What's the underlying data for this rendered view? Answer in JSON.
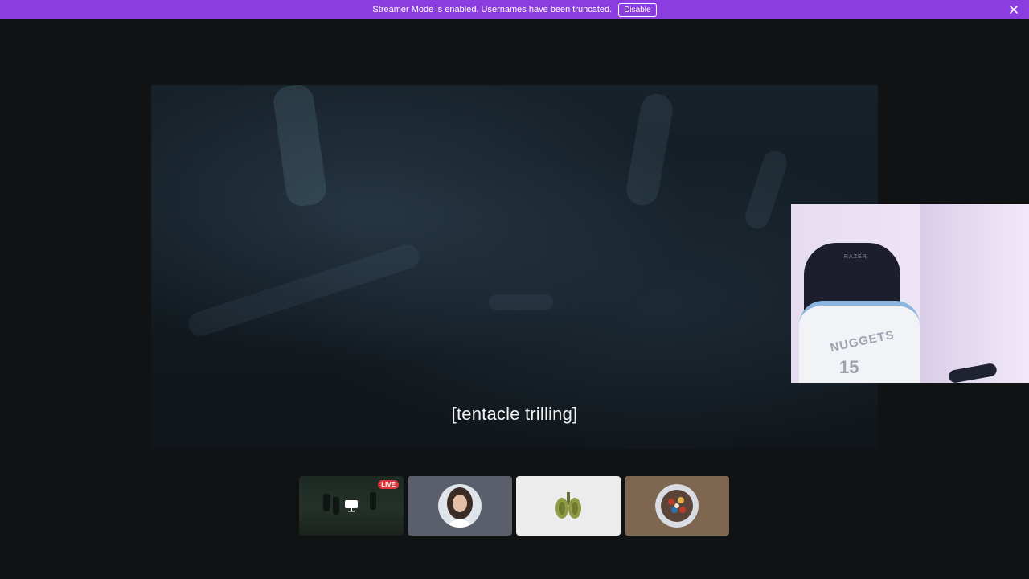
{
  "banner": {
    "message": "Streamer Mode is enabled. Usernames have been truncated.",
    "disable_label": "Disable",
    "background": "#8b3ddf"
  },
  "stage": {
    "caption": "[tentacle trilling]"
  },
  "webcam": {
    "chair_logo": "RAZER",
    "jersey_text": "NUGGETS",
    "jersey_number": "15"
  },
  "participants": [
    {
      "type": "screen-share",
      "live_label": "LIVE",
      "icon": "screen-share-icon"
    },
    {
      "type": "avatar",
      "icon": "woman-avatar"
    },
    {
      "type": "avatar",
      "icon": "lungs-avatar"
    },
    {
      "type": "avatar",
      "icon": "crowd-photo-avatar"
    }
  ]
}
